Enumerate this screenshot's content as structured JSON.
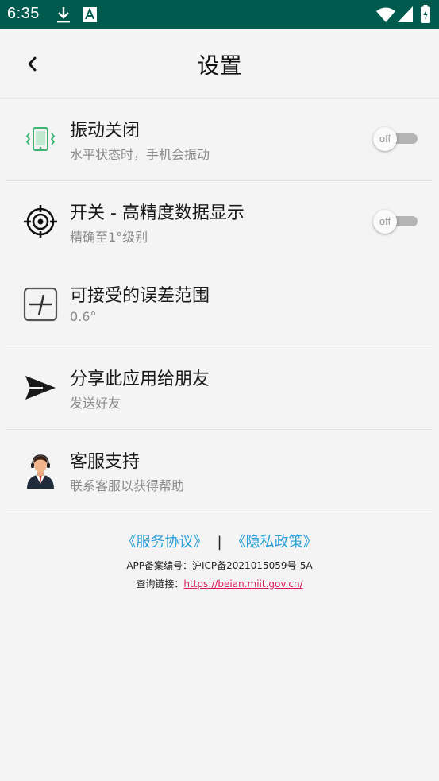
{
  "status_bar": {
    "time": "6:35",
    "left_icons": [
      "download-icon",
      "a-box-icon"
    ],
    "right_icons": [
      "wifi-icon",
      "cellular-icon",
      "battery-icon"
    ],
    "background": "#005b4e"
  },
  "app_bar": {
    "title": "设置",
    "back_icon": "chevron-left-icon"
  },
  "settings": [
    {
      "icon": "vibration-phone-icon",
      "title": "振动关闭",
      "subtitle": "水平状态时，手机会振动",
      "toggle": "off"
    },
    {
      "icon": "crosshair-target-icon",
      "title": "开关 - 高精度数据显示",
      "subtitle": "精确至1°级别",
      "toggle": "off"
    },
    {
      "icon": "tolerance-box-icon",
      "title": "可接受的误差范围",
      "subtitle": "0.6°"
    },
    {
      "icon": "send-arrow-icon",
      "title": "分享此应用给朋友",
      "subtitle": "发送好友"
    },
    {
      "icon": "customer-service-avatar-icon",
      "title": "客服支持",
      "subtitle": "联系客服以获得帮助"
    }
  ],
  "footer": {
    "service_agreement": "《服务协议》",
    "separator": "|",
    "privacy_policy": "《隐私政策》",
    "beian": "APP备案编号：沪ICP备2021015059号-5A",
    "query_label": "查询链接：",
    "query_url": "https://beian.miit.gov.cn/"
  },
  "colors": {
    "link": "#2a9fd6",
    "url": "#d81b60",
    "vibration_icon": "#3cb371"
  }
}
